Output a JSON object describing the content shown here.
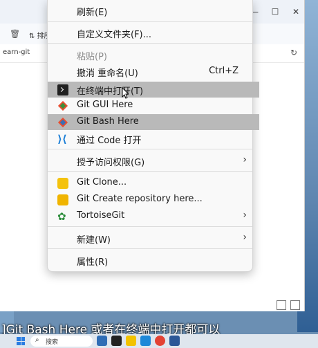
{
  "explorer": {
    "toolbar": {
      "sort_label": "排序"
    },
    "address": {
      "path": "earn-git"
    }
  },
  "menu": {
    "items": [
      {
        "label": "刷新(E)",
        "shortcut": "",
        "disabled": false
      },
      {
        "label": "自定义文件夹(F)...",
        "shortcut": "",
        "disabled": false
      },
      {
        "label": "粘贴(P)",
        "shortcut": "",
        "disabled": true
      },
      {
        "label": "撤消 重命名(U)",
        "shortcut": "Ctrl+Z",
        "disabled": false
      },
      {
        "label": "在终端中打开(T)",
        "icon": "terminal-icon",
        "highlighted": true
      },
      {
        "label": "Git GUI Here",
        "icon": "git-gui-icon"
      },
      {
        "label": "Git Bash Here",
        "icon": "git-bash-icon",
        "highlighted": true
      },
      {
        "label": "通过 Code 打开",
        "icon": "vscode-icon"
      },
      {
        "label": "授予访问权限(G)",
        "submenu": true
      },
      {
        "label": "Git Clone...",
        "icon": "git-clone-icon"
      },
      {
        "label": "Git Create repository here...",
        "icon": "git-create-repo-icon"
      },
      {
        "label": "TortoiseGit",
        "icon": "tortoisegit-icon",
        "submenu": true
      },
      {
        "label": "新建(W)",
        "submenu": true
      },
      {
        "label": "属性(R)"
      }
    ]
  },
  "subtitle": {
    "text": "]Git Bash Here 或者在终端中打开都可以"
  },
  "taskbar": {
    "search_placeholder": "搜索"
  },
  "colors": {
    "highlight": "#b9b9b9",
    "menu_bg": "#f9f9f9",
    "vscode_blue": "#1b7ed6",
    "git_orange": "#e84e31"
  }
}
